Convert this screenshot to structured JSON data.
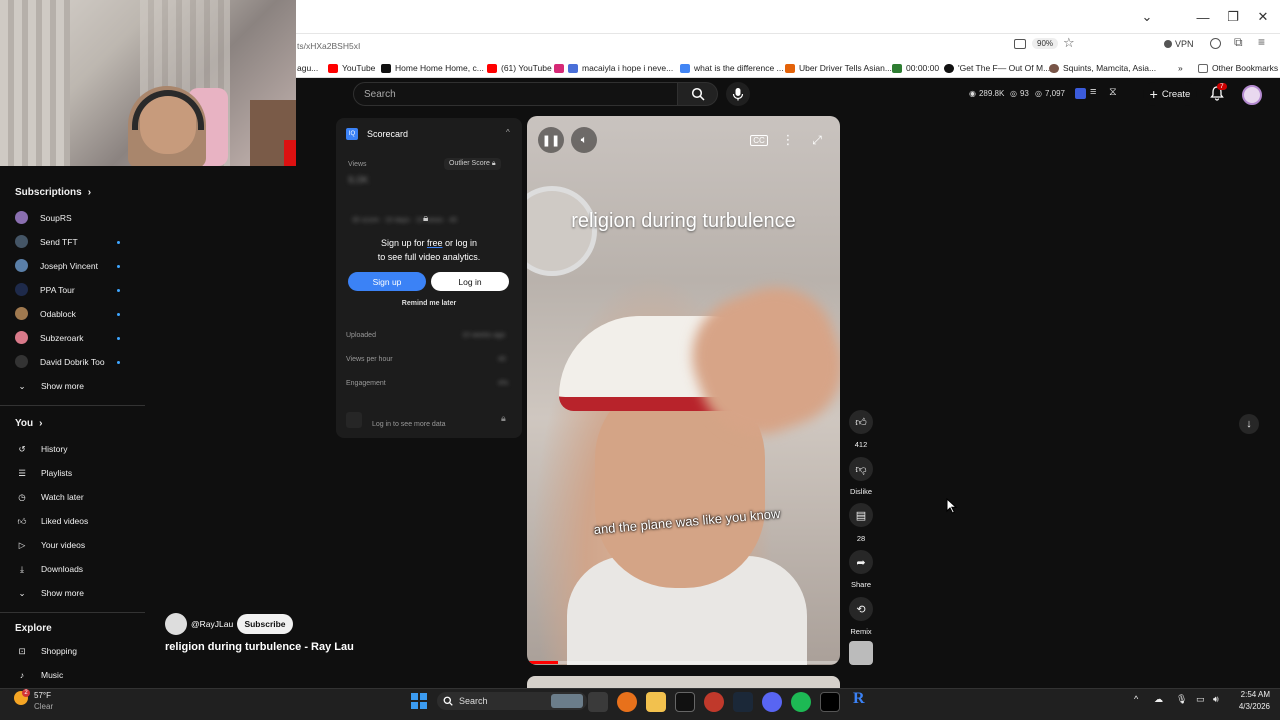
{
  "browser": {
    "url": "ts/xHXa2BSH5xI",
    "zoom": "90%",
    "vpn_label": "VPN",
    "bookmarks": [
      {
        "label": "agu...",
        "color": "#c33"
      },
      {
        "label": "YouTube",
        "color": "#ff0000"
      },
      {
        "label": "Home Home Home, c...",
        "color": "#111111"
      },
      {
        "label": "(61) YouTube",
        "color": "#ff0000"
      },
      {
        "label": "macaiyla i hope i neve...",
        "color": "#d62976"
      },
      {
        "label": "what is the difference ...",
        "color": "#4285f4"
      },
      {
        "label": "Uber Driver Tells Asian...",
        "color": "#e36209"
      },
      {
        "label": "00:00:00",
        "color": "#2e7d32"
      },
      {
        "label": "'Get The F— Out Of M...",
        "color": "#111111"
      },
      {
        "label": "Squints, Mamcita, Asia...",
        "color": "#795548"
      }
    ],
    "other_bookmarks": "Other Bookmarks"
  },
  "header": {
    "search_placeholder": "Search",
    "stats": {
      "views": "289.8K",
      "comments": "93",
      "likes": "7,097"
    },
    "create_label": "Create",
    "notification_count": "7"
  },
  "sidebar": {
    "subscriptions_title": "Subscriptions",
    "subscriptions": [
      {
        "label": "SoupRS",
        "color": "#8a6fb0",
        "new": false
      },
      {
        "label": "Send TFT",
        "color": "#456",
        "new": true
      },
      {
        "label": "Joseph Vincent",
        "color": "#5a7fa8",
        "new": true
      },
      {
        "label": "PPA Tour",
        "color": "#1e2a4a",
        "new": true
      },
      {
        "label": "Odablock",
        "color": "#a0794f",
        "new": true
      },
      {
        "label": "Subzeroark",
        "color": "#d97a8a",
        "new": true
      },
      {
        "label": "David Dobrik Too",
        "color": "#333",
        "new": true
      }
    ],
    "show_more_1": "Show more",
    "you_title": "You",
    "you_items": [
      {
        "label": "History",
        "icon": "history-icon"
      },
      {
        "label": "Playlists",
        "icon": "playlists-icon"
      },
      {
        "label": "Watch later",
        "icon": "clock-icon"
      },
      {
        "label": "Liked videos",
        "icon": "thumbs-up-icon"
      },
      {
        "label": "Your videos",
        "icon": "play-icon"
      },
      {
        "label": "Downloads",
        "icon": "download-icon"
      }
    ],
    "show_more_2": "Show more",
    "explore_title": "Explore",
    "explore_items": [
      {
        "label": "Shopping",
        "icon": "shopping-bag-icon"
      },
      {
        "label": "Music",
        "icon": "music-icon"
      }
    ]
  },
  "scorecard": {
    "title": "Scorecard",
    "views_label": "Views",
    "outlier_label": "Outlier Score",
    "signup_prompt_1": "Sign up for",
    "signup_prompt_free": "free",
    "signup_prompt_2": "or log in",
    "signup_prompt_3": "to see full video analytics.",
    "signup_btn": "Sign up",
    "login_btn": "Log in",
    "remind": "Remind me later",
    "uploaded": "Uploaded",
    "views_per_hour": "Views per hour",
    "engagement": "Engagement",
    "login_more": "Log in to see more data"
  },
  "video": {
    "overlay_title": "religion during turbulence",
    "caption": "and the plane was like you know",
    "progress": 0.1
  },
  "actions": {
    "likes": "412",
    "dislike": "Dislike",
    "comments": "28",
    "share": "Share",
    "remix": "Remix"
  },
  "channel": {
    "handle": "@RayJLau",
    "subscribe": "Subscribe",
    "video_title": "religion during turbulence - Ray Lau"
  },
  "taskbar": {
    "weather_temp": "57°F",
    "weather_desc": "Clear",
    "weather_badge": "2",
    "search_label": "Search",
    "time": "2:54 AM",
    "date": "4/3/2026"
  }
}
